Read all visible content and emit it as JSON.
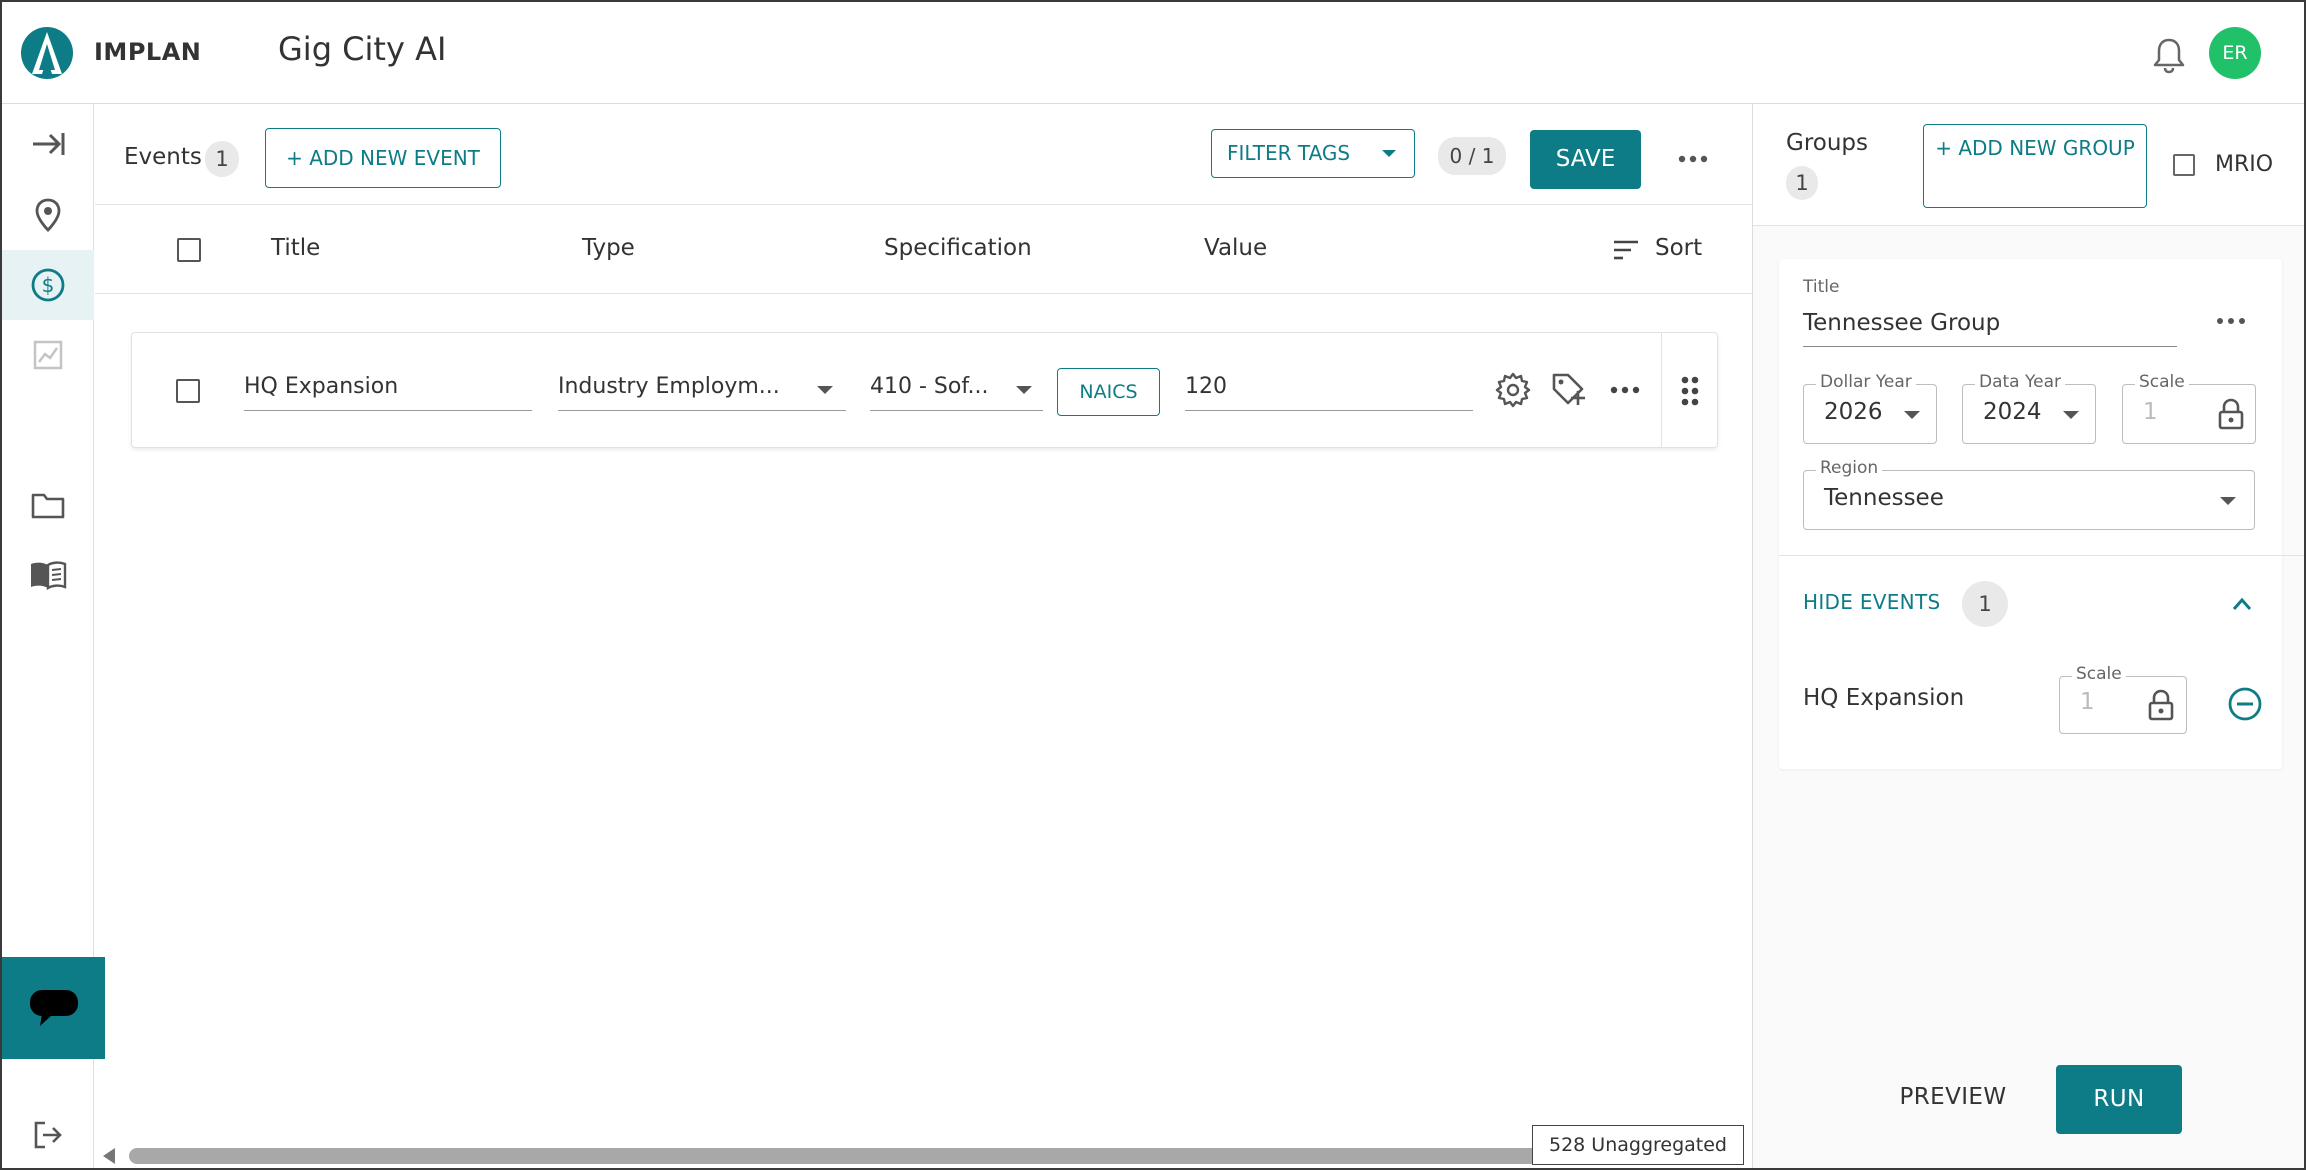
{
  "header": {
    "brand": "IMPLAN",
    "app_title": "Gig City AI",
    "avatar_initials": "ER",
    "accent_color": "#0e7c86",
    "avatar_color": "#21c16a"
  },
  "sidebar": {
    "items": [
      {
        "icon": "expand-arrow-icon"
      },
      {
        "icon": "location-pin-icon"
      },
      {
        "icon": "dollar-circle-icon",
        "active": true
      },
      {
        "icon": "chart-icon"
      },
      {
        "icon": "folder-icon"
      },
      {
        "icon": "book-icon"
      }
    ],
    "bottom_icon": "logout-icon",
    "chat_icon": "chat-bubble-icon"
  },
  "events": {
    "label": "Events",
    "count": "1",
    "add_label": "+ ADD NEW EVENT",
    "filter_label": "FILTER TAGS",
    "save_count": "0 / 1",
    "save_label": "SAVE",
    "columns": {
      "title": "Title",
      "type": "Type",
      "specification": "Specification",
      "value": "Value",
      "sort": "Sort"
    },
    "rows": [
      {
        "title": "HQ Expansion",
        "type": "Industry Employm...",
        "specification": "410 - Sof...",
        "code_tag": "NAICS",
        "value": "120"
      }
    ],
    "unaggregated": "528 Unaggregated"
  },
  "groups": {
    "label": "Groups",
    "count": "1",
    "add_label": "+ ADD NEW GROUP",
    "mrio_label": "MRIO",
    "group": {
      "title_label": "Title",
      "title": "Tennessee Group",
      "dollar_year_label": "Dollar Year",
      "dollar_year": "2026",
      "data_year_label": "Data Year",
      "data_year": "2024",
      "scale_label": "Scale",
      "scale": "1",
      "region_label": "Region",
      "region": "Tennessee",
      "hide_events_label": "HIDE EVENTS",
      "hide_events_count": "1",
      "events": [
        {
          "name": "HQ Expansion",
          "scale_label": "Scale",
          "scale": "1"
        }
      ]
    },
    "preview_label": "PREVIEW",
    "run_label": "RUN"
  }
}
